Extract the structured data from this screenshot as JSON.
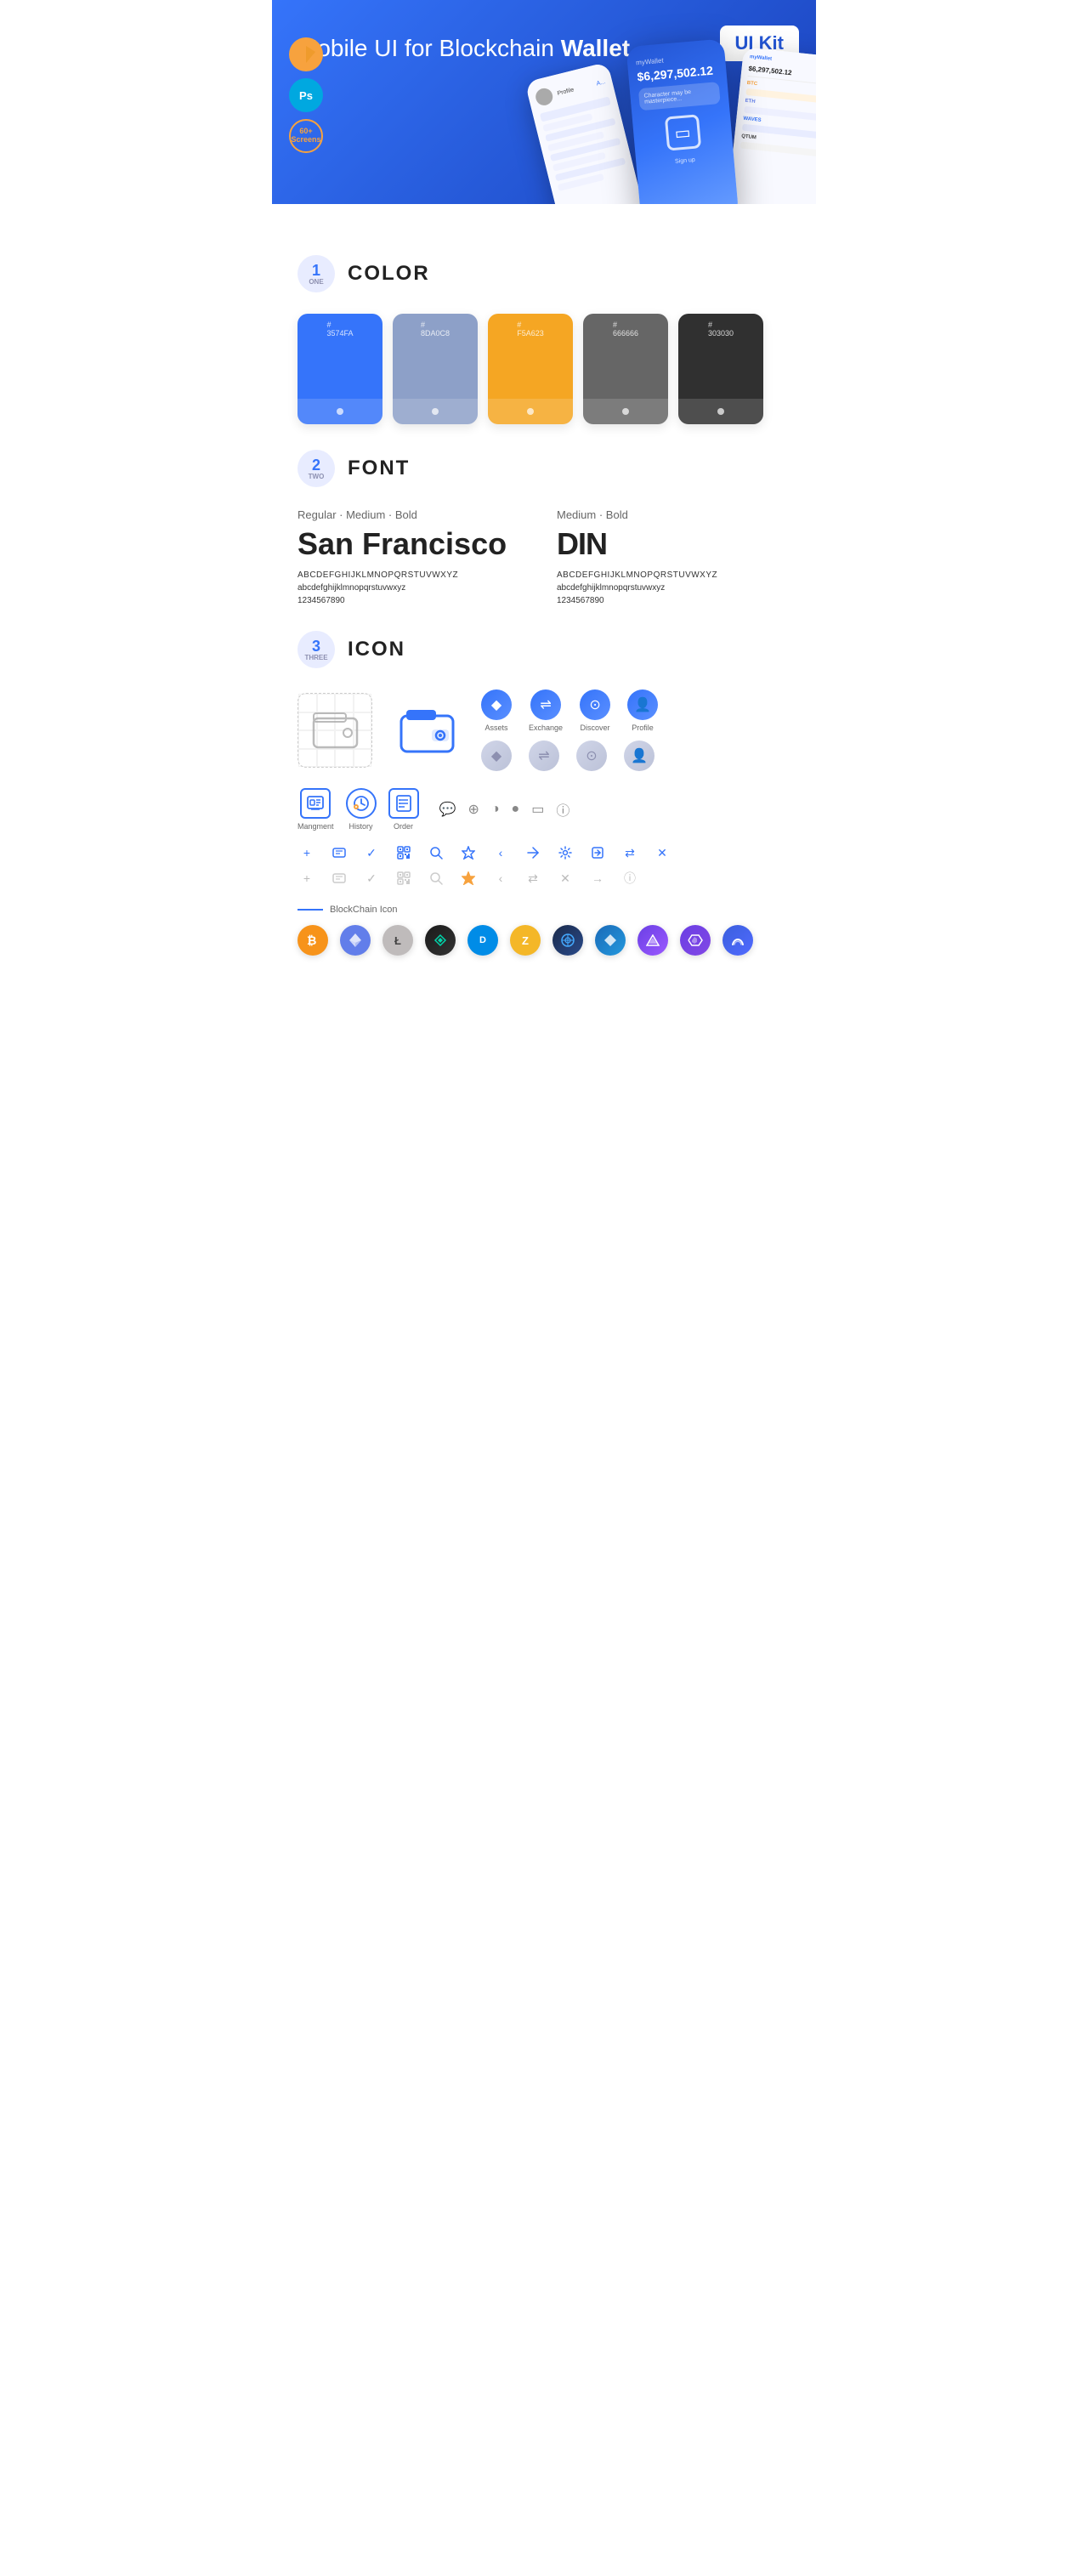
{
  "hero": {
    "title_normal": "Mobile UI for Blockchain ",
    "title_bold": "Wallet",
    "badge": "UI Kit",
    "sketch_label": "Sketch",
    "ps_label": "PS",
    "screens_label": "60+\nScreens"
  },
  "sections": {
    "color": {
      "number": "1",
      "sub": "ONE",
      "title": "COLOR",
      "swatches": [
        {
          "hex": "#3574FA",
          "label": "#\n3574FA"
        },
        {
          "hex": "#8DA0C8",
          "label": "#\n8DA0C8"
        },
        {
          "hex": "#F5A623",
          "label": "#\nF5A623"
        },
        {
          "hex": "#666666",
          "label": "#\n666666"
        },
        {
          "hex": "#303030",
          "label": "#\n303030"
        }
      ]
    },
    "font": {
      "number": "2",
      "sub": "TWO",
      "title": "FONT",
      "font1": {
        "weights": "Regular · Medium · Bold",
        "name": "San Francisco",
        "uppercase": "ABCDEFGHIJKLMNOPQRSTUVWXYZ",
        "lowercase": "abcdefghijklmnopqrstuvwxyz",
        "numbers": "1234567890"
      },
      "font2": {
        "weights": "Medium · Bold",
        "name": "DIN",
        "uppercase": "ABCDEFGHIJKLMNOPQRSTUVWXYZ",
        "lowercase": "abcdefghijklmnopqrstuvwxyz",
        "numbers": "1234567890"
      }
    },
    "icon": {
      "number": "3",
      "sub": "THREE",
      "title": "ICON",
      "nav_icons": [
        {
          "label": "Assets",
          "icon": "◆"
        },
        {
          "label": "Exchange",
          "icon": "⇌"
        },
        {
          "label": "Discover",
          "icon": "⊙"
        },
        {
          "label": "Profile",
          "icon": "⌂"
        }
      ],
      "action_icons": [
        {
          "label": "Mangment",
          "type": "management"
        },
        {
          "label": "History",
          "type": "history"
        },
        {
          "label": "Order",
          "type": "order"
        }
      ],
      "misc_icons_row1": [
        "+",
        "⊞",
        "✓",
        "⊡",
        "⌕",
        "☆",
        "‹",
        "≮",
        "⚙",
        "⊡",
        "⟺",
        "✕"
      ],
      "misc_icons_row2": [
        "+",
        "⊞",
        "✓",
        "⊡",
        "⌕",
        "☆",
        "‹",
        "≈",
        "✕",
        "→",
        "ⓘ"
      ],
      "blockchain_label": "BlockChain Icon",
      "crypto_icons": [
        {
          "name": "BTC",
          "class": "crypto-btc"
        },
        {
          "name": "ETH",
          "class": "crypto-eth"
        },
        {
          "name": "LTC",
          "class": "crypto-ltc"
        },
        {
          "name": "WAVES",
          "class": "crypto-waves"
        },
        {
          "name": "DASH",
          "class": "crypto-dash"
        },
        {
          "name": "ZEC",
          "class": "crypto-zcash"
        },
        {
          "name": "GRID",
          "class": "crypto-grid"
        },
        {
          "name": "STRAT",
          "class": "crypto-strat"
        },
        {
          "name": "NAV",
          "class": "crypto-nav"
        },
        {
          "name": "MATIC",
          "class": "crypto-matic"
        },
        {
          "name": "BAND",
          "class": "crypto-band"
        }
      ]
    }
  }
}
